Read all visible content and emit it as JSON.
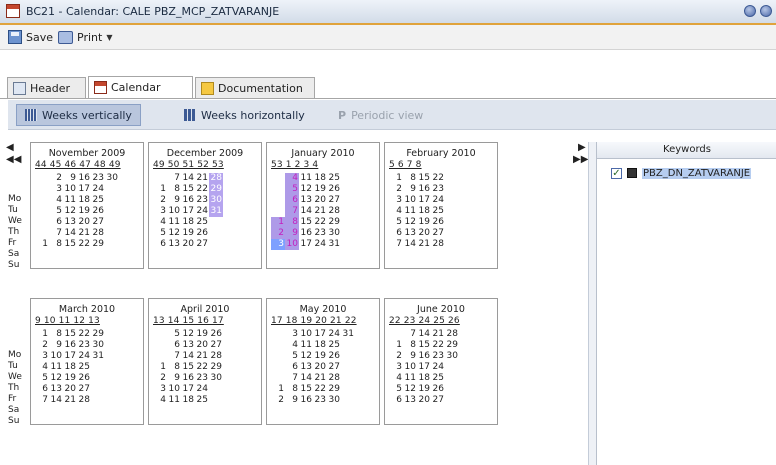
{
  "window": {
    "title": "BC21 - Calendar: CALE PBZ_MCP_ZATVARANJE"
  },
  "toolbar": {
    "save_label": "Save",
    "print_label": "Print"
  },
  "tabs": [
    {
      "label": "Header"
    },
    {
      "label": "Calendar"
    },
    {
      "label": "Documentation"
    }
  ],
  "view_modes": [
    {
      "label": "Weeks vertically"
    },
    {
      "label": "Weeks horizontally"
    },
    {
      "label": "Periodic view"
    }
  ],
  "day_labels": [
    "Mo",
    "Tu",
    "We",
    "Th",
    "Fr",
    "Sa",
    "Su"
  ],
  "months": [
    {
      "name": "November 2009",
      "weeks": "44 45 46 47 48 49",
      "rows": [
        [
          "",
          "2",
          "9",
          "16",
          "23",
          "30"
        ],
        [
          "",
          "3",
          "10",
          "17",
          "24",
          ""
        ],
        [
          "",
          "4",
          "11",
          "18",
          "25",
          ""
        ],
        [
          "",
          "5",
          "12",
          "19",
          "26",
          ""
        ],
        [
          "",
          "6",
          "13",
          "20",
          "27",
          ""
        ],
        [
          "",
          "7",
          "14",
          "21",
          "28",
          ""
        ],
        [
          "1",
          "8",
          "15",
          "22",
          "29",
          ""
        ]
      ]
    },
    {
      "name": "December 2009",
      "weeks": "49 50 51 52 53",
      "rows": [
        [
          "",
          "7",
          "14",
          "21",
          "28"
        ],
        [
          "1",
          "8",
          "15",
          "22",
          "29"
        ],
        [
          "2",
          "9",
          "16",
          "23",
          "30"
        ],
        [
          "3",
          "10",
          "17",
          "24",
          "31"
        ],
        [
          "4",
          "11",
          "18",
          "25",
          ""
        ],
        [
          "5",
          "12",
          "19",
          "26",
          ""
        ],
        [
          "6",
          "13",
          "20",
          "27",
          ""
        ]
      ]
    },
    {
      "name": "January 2010",
      "weeks": "53 1 2 3 4",
      "rows": [
        [
          "",
          "4",
          "11",
          "18",
          "25"
        ],
        [
          "",
          "5",
          "12",
          "19",
          "26"
        ],
        [
          "",
          "6",
          "13",
          "20",
          "27"
        ],
        [
          "",
          "7",
          "14",
          "21",
          "28"
        ],
        [
          "1",
          "8",
          "15",
          "22",
          "29"
        ],
        [
          "2",
          "9",
          "16",
          "23",
          "30"
        ],
        [
          "3",
          "10",
          "17",
          "24",
          "31"
        ]
      ]
    },
    {
      "name": "February 2010",
      "weeks": "5 6 7 8",
      "rows": [
        [
          "1",
          "8",
          "15",
          "22"
        ],
        [
          "2",
          "9",
          "16",
          "23"
        ],
        [
          "3",
          "10",
          "17",
          "24"
        ],
        [
          "4",
          "11",
          "18",
          "25"
        ],
        [
          "5",
          "12",
          "19",
          "26"
        ],
        [
          "6",
          "13",
          "20",
          "27"
        ],
        [
          "7",
          "14",
          "21",
          "28"
        ]
      ]
    },
    {
      "name": "March 2010",
      "weeks": "9 10 11 12 13",
      "rows": [
        [
          "1",
          "8",
          "15",
          "22",
          "29"
        ],
        [
          "2",
          "9",
          "16",
          "23",
          "30"
        ],
        [
          "3",
          "10",
          "17",
          "24",
          "31"
        ],
        [
          "4",
          "11",
          "18",
          "25",
          ""
        ],
        [
          "5",
          "12",
          "19",
          "26",
          ""
        ],
        [
          "6",
          "13",
          "20",
          "27",
          ""
        ],
        [
          "7",
          "14",
          "21",
          "28",
          ""
        ]
      ]
    },
    {
      "name": "April 2010",
      "weeks": "13 14 15 16 17",
      "rows": [
        [
          "",
          "5",
          "12",
          "19",
          "26"
        ],
        [
          "",
          "6",
          "13",
          "20",
          "27"
        ],
        [
          "",
          "7",
          "14",
          "21",
          "28"
        ],
        [
          "1",
          "8",
          "15",
          "22",
          "29"
        ],
        [
          "2",
          "9",
          "16",
          "23",
          "30"
        ],
        [
          "3",
          "10",
          "17",
          "24",
          ""
        ],
        [
          "4",
          "11",
          "18",
          "25",
          ""
        ]
      ]
    },
    {
      "name": "May 2010",
      "weeks": "17 18 19 20 21 22",
      "rows": [
        [
          "",
          "3",
          "10",
          "17",
          "24",
          "31"
        ],
        [
          "",
          "4",
          "11",
          "18",
          "25",
          ""
        ],
        [
          "",
          "5",
          "12",
          "19",
          "26",
          ""
        ],
        [
          "",
          "6",
          "13",
          "20",
          "27",
          ""
        ],
        [
          "",
          "7",
          "14",
          "21",
          "28",
          ""
        ],
        [
          "1",
          "8",
          "15",
          "22",
          "29",
          ""
        ],
        [
          "2",
          "9",
          "16",
          "23",
          "30",
          ""
        ]
      ]
    },
    {
      "name": "June 2010",
      "weeks": "22 23 24 25 26",
      "rows": [
        [
          "",
          "7",
          "14",
          "21",
          "28"
        ],
        [
          "1",
          "8",
          "15",
          "22",
          "29"
        ],
        [
          "2",
          "9",
          "16",
          "23",
          "30"
        ],
        [
          "3",
          "10",
          "17",
          "24",
          ""
        ],
        [
          "4",
          "11",
          "18",
          "25",
          ""
        ],
        [
          "5",
          "12",
          "19",
          "26",
          ""
        ],
        [
          "6",
          "13",
          "20",
          "27",
          ""
        ]
      ]
    }
  ],
  "highlights": {
    "December 2009": [
      "28",
      "29",
      "30",
      "31"
    ],
    "January 2010": [
      "1",
      "2",
      "3",
      "4",
      "5",
      "6",
      "7",
      "8",
      "9",
      "10"
    ]
  },
  "nav": {
    "prev": "◀",
    "prev_fast": "◀◀",
    "next": "▶",
    "next_fast": "▶▶"
  },
  "keywords": {
    "header": "Keywords",
    "items": [
      {
        "label": "PBZ_DN_ZATVARANJE",
        "checked": true
      }
    ]
  }
}
